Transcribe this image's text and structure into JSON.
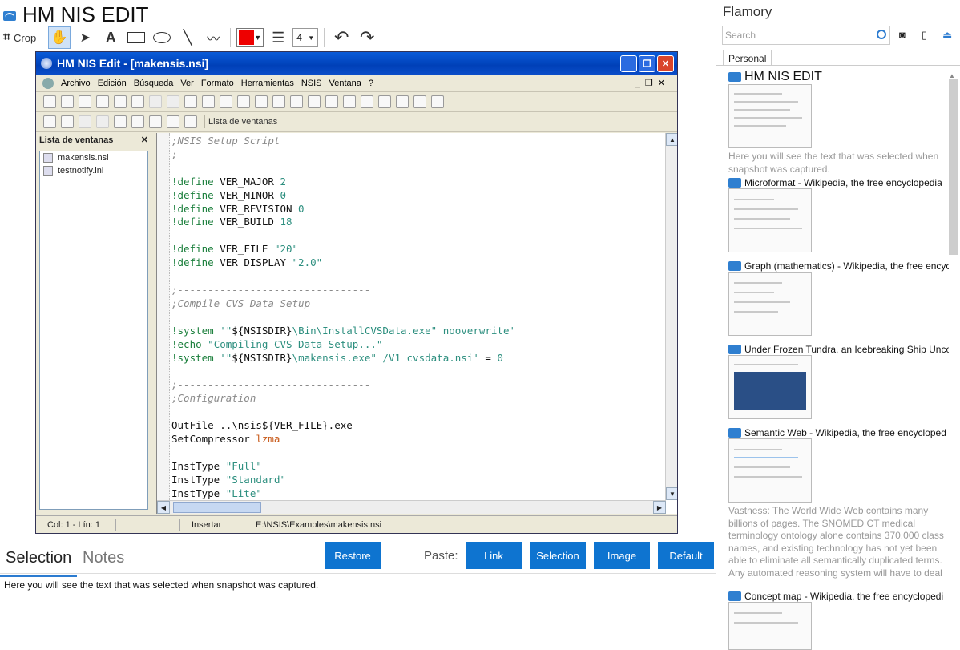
{
  "app": {
    "title": "HM NIS EDIT"
  },
  "toolbar": {
    "crop_label": "Crop",
    "line_width": "4",
    "color": "#ee0000"
  },
  "screenshot": {
    "title": "HM NIS Edit - [makensis.nsi]",
    "menu": [
      "Archivo",
      "Edición",
      "Búsqueda",
      "Ver",
      "Formato",
      "Herramientas",
      "NSIS",
      "Ventana",
      "?"
    ],
    "toolbar_text": "Lista de ventanas",
    "panel_title": "Lista de ventanas",
    "files": [
      "makensis.nsi",
      "testnotify.ini"
    ],
    "status": {
      "pos": "Col: 1 - Lín: 1",
      "mode": "Insertar",
      "path": "E:\\NSIS\\Examples\\makensis.nsi"
    }
  },
  "bottom": {
    "tab_selection": "Selection",
    "tab_notes": "Notes",
    "restore": "Restore",
    "paste_label": "Paste:",
    "link": "Link",
    "selection": "Selection",
    "image": "Image",
    "default": "Default",
    "selected_text": "Here you will see the text that was selected when snapshot was captured."
  },
  "sidebar": {
    "title": "Flamory",
    "search_placeholder": "Search",
    "tab": "Personal",
    "items": [
      {
        "title": "HM NIS EDIT",
        "desc": "Here you will see the text that was selected when snapshot was captured."
      },
      {
        "title": "Microformat - Wikipedia, the free encyclopedia",
        "desc": ""
      },
      {
        "title": "Graph (mathematics) - Wikipedia, the free encyc",
        "desc": ""
      },
      {
        "title": "Under Frozen Tundra, an Icebreaking Ship Unco",
        "desc": ""
      },
      {
        "title": "Semantic Web - Wikipedia, the free encycloped",
        "desc": "Vastness: The World Wide Web contains many billions of pages. The SNOMED CT medical terminology ontology alone contains 370,000 class names, and existing technology has not yet been able to eliminate all semantically duplicated terms. Any automated reasoning system will have to deal with truly huge inputs."
      },
      {
        "title": "Concept map - Wikipedia, the free encyclopedi",
        "desc": ""
      }
    ]
  }
}
